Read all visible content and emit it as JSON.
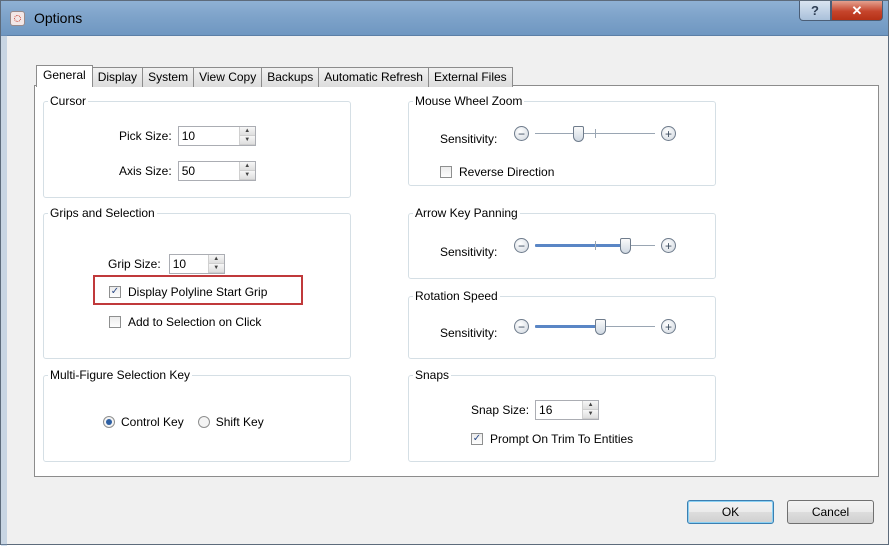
{
  "window": {
    "title": "Options",
    "help_glyph": "?",
    "close_glyph": "✕"
  },
  "tabs": [
    {
      "label": "General",
      "active": true
    },
    {
      "label": "Display"
    },
    {
      "label": "System"
    },
    {
      "label": "View Copy"
    },
    {
      "label": "Backups"
    },
    {
      "label": "Automatic Refresh"
    },
    {
      "label": "External Files"
    }
  ],
  "cursor": {
    "legend": "Cursor",
    "pick_size_label": "Pick Size:",
    "pick_size_value": "10",
    "axis_size_label": "Axis Size:",
    "axis_size_value": "50"
  },
  "grips": {
    "legend": "Grips and Selection",
    "grip_size_label": "Grip Size:",
    "grip_size_value": "10",
    "display_start_grip_label": "Display Polyline Start Grip",
    "display_start_grip_checked": true,
    "add_on_click_label": "Add to Selection on Click",
    "add_on_click_checked": false
  },
  "multi_key": {
    "legend": "Multi-Figure Selection Key",
    "options": [
      "Control Key",
      "Shift Key"
    ],
    "selected": "Control Key"
  },
  "mouse_zoom": {
    "legend": "Mouse Wheel Zoom",
    "sensitivity_label": "Sensitivity:",
    "sensitivity_fraction": 0.35,
    "reverse_label": "Reverse Direction",
    "reverse_checked": false
  },
  "arrow_panning": {
    "legend": "Arrow Key Panning",
    "sensitivity_label": "Sensitivity:",
    "sensitivity_fraction": 0.78
  },
  "rotation": {
    "legend": "Rotation Speed",
    "sensitivity_label": "Sensitivity:",
    "sensitivity_fraction": 0.55
  },
  "snaps": {
    "legend": "Snaps",
    "snap_size_label": "Snap Size:",
    "snap_size_value": "16",
    "prompt_label": "Prompt On Trim To Entities",
    "prompt_checked": true
  },
  "buttons": {
    "ok": "OK",
    "cancel": "Cancel"
  },
  "icons": {
    "minus": "−",
    "plus": "+",
    "check": "✓",
    "up": "▲",
    "down": "▼"
  }
}
